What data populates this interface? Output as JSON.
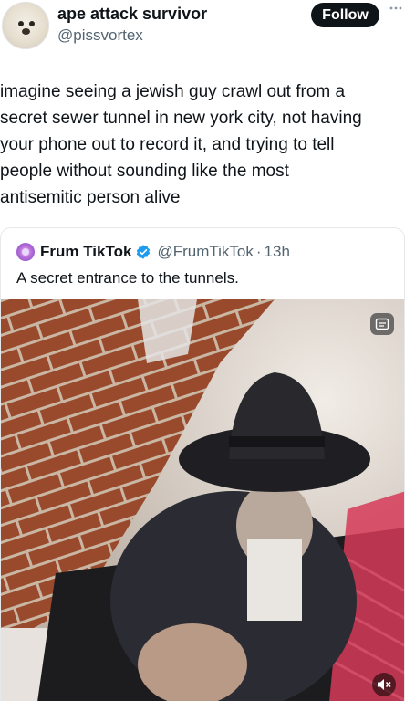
{
  "header": {
    "display_name": "ape attack survivor",
    "handle": "@pissvortex",
    "follow_label": "Follow",
    "more_icon": "more-icon"
  },
  "tweet": {
    "lines": [
      "imagine seeing a jewish guy crawl out from a",
      "secret sewer tunnel in new york city, not having",
      "your phone out to record it, and trying to tell",
      "people without sounding like the most",
      "antisemitic person alive"
    ]
  },
  "quote": {
    "name": "Frum TikTok",
    "handle": "@FrumTikTok",
    "separator": "·",
    "time": "13h",
    "text": "A secret entrance to the tunnels.",
    "verified_color": "#1d9bf0"
  },
  "media": {
    "alt_icon": "alt-text-icon",
    "mute_icon": "volume-muted-icon"
  },
  "colors": {
    "text": "#0f1419",
    "secondary": "#536471",
    "follow_bg": "#0f1419"
  }
}
